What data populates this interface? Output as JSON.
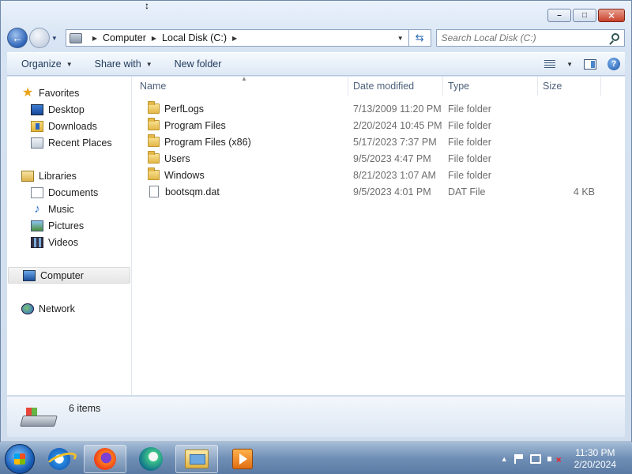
{
  "window": {
    "caption_buttons": [
      {
        "name": "minimize-button",
        "glyph": "–"
      },
      {
        "name": "maximize-button",
        "glyph": "□"
      },
      {
        "name": "close-button",
        "glyph": "✕"
      }
    ]
  },
  "address": {
    "crumbs": [
      "Computer",
      "Local Disk (C:)"
    ]
  },
  "search": {
    "placeholder": "Search Local Disk (C:)"
  },
  "toolbar": {
    "organize_label": "Organize",
    "share_label": "Share with",
    "new_folder_label": "New folder"
  },
  "navpane": {
    "favorites": {
      "label": "Favorites",
      "items": [
        "Desktop",
        "Downloads",
        "Recent Places"
      ]
    },
    "libraries": {
      "label": "Libraries",
      "items": [
        "Documents",
        "Music",
        "Pictures",
        "Videos"
      ]
    },
    "computer": {
      "label": "Computer"
    },
    "network": {
      "label": "Network"
    }
  },
  "columns": {
    "name": "Name",
    "date": "Date modified",
    "type": "Type",
    "size": "Size"
  },
  "files": [
    {
      "name": "PerfLogs",
      "date": "7/13/2009 11:20 PM",
      "type": "File folder",
      "size": "",
      "kind": "folder"
    },
    {
      "name": "Program Files",
      "date": "2/20/2024 10:45 PM",
      "type": "File folder",
      "size": "",
      "kind": "folder"
    },
    {
      "name": "Program Files (x86)",
      "date": "5/17/2023 7:37 PM",
      "type": "File folder",
      "size": "",
      "kind": "folder"
    },
    {
      "name": "Users",
      "date": "9/5/2023 4:47 PM",
      "type": "File folder",
      "size": "",
      "kind": "folder"
    },
    {
      "name": "Windows",
      "date": "8/21/2023 1:07 AM",
      "type": "File folder",
      "size": "",
      "kind": "folder"
    },
    {
      "name": "bootsqm.dat",
      "date": "9/5/2023 4:01 PM",
      "type": "DAT File",
      "size": "4 KB",
      "kind": "file"
    }
  ],
  "details": {
    "item_count": "6 items"
  },
  "taskbar": {
    "apps": [
      "internet-explorer",
      "firefox",
      "edge",
      "windows-explorer",
      "media-player"
    ],
    "time": "11:30 PM",
    "date": "2/20/2024"
  }
}
